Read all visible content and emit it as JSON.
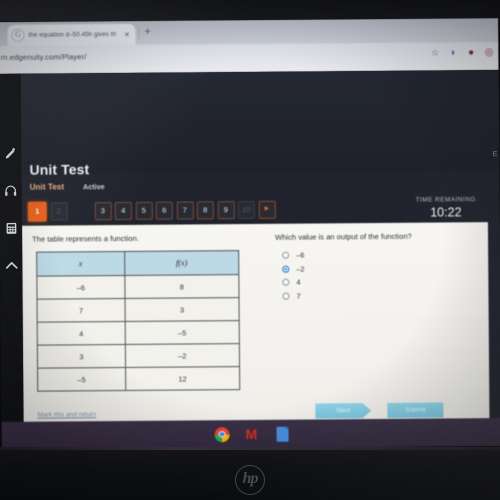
{
  "browser": {
    "tab": {
      "favicon": "google-g-icon",
      "title": "the equation d–50.45h gives th",
      "close": "✕"
    },
    "new_tab_label": "+",
    "url": "rn.edgenuity.com/Player/",
    "toolbar_icons": [
      "star-icon",
      "extension-icon",
      "extension-icon",
      "profile-icon"
    ]
  },
  "app": {
    "title": "Unit Test",
    "subtitle": "Unit Test",
    "status": "Active",
    "timer": {
      "label": "TIME REMAINING",
      "value": "10:22"
    },
    "question_nav": [
      {
        "label": "1",
        "state": "active"
      },
      {
        "label": "2",
        "state": "dim"
      },
      {
        "label": "3",
        "state": "normal"
      },
      {
        "label": "4",
        "state": "normal"
      },
      {
        "label": "5",
        "state": "normal"
      },
      {
        "label": "6",
        "state": "normal"
      },
      {
        "label": "7",
        "state": "normal"
      },
      {
        "label": "8",
        "state": "normal"
      },
      {
        "label": "9",
        "state": "normal"
      },
      {
        "label": "10",
        "state": "dim"
      },
      {
        "label": "▶",
        "state": "play"
      }
    ],
    "rail_icons": [
      "highlighter-icon",
      "headphones-icon",
      "calculator-icon",
      "arrow-up-icon"
    ]
  },
  "question": {
    "prompt": "The table represents a function.",
    "table": {
      "headers": [
        "x",
        "f(x)"
      ],
      "rows": [
        [
          "–6",
          "8"
        ],
        [
          "7",
          "3"
        ],
        [
          "4",
          "–5"
        ],
        [
          "3",
          "–2"
        ],
        [
          "–5",
          "12"
        ]
      ]
    },
    "question_text": "Which value is an output of the function?",
    "options": [
      {
        "label": "–6",
        "selected": false
      },
      {
        "label": "–2",
        "selected": true
      },
      {
        "label": "4",
        "selected": false
      },
      {
        "label": "7",
        "selected": false
      }
    ],
    "mark_link": "Mark this and return",
    "next_button": "Next",
    "submit_button": "Submit"
  },
  "taskbar": {
    "icons": [
      "chrome-icon",
      "gmail-icon",
      "google-docs-icon"
    ]
  },
  "device": {
    "brand": "hp"
  }
}
